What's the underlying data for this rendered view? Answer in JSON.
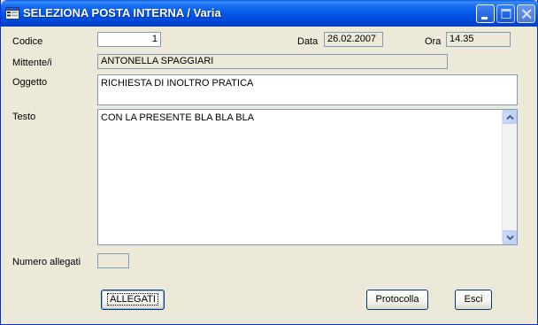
{
  "window": {
    "title": "SELEZIONA POSTA INTERNA / Varia",
    "icon": "form-icon",
    "controls": [
      "minimize-icon",
      "maximize-icon",
      "close-icon"
    ]
  },
  "form": {
    "codice": {
      "label": "Codice",
      "value": "1"
    },
    "data": {
      "label": "Data",
      "value": "26.02.2007"
    },
    "ora": {
      "label": "Ora",
      "value": "14.35"
    },
    "mittente": {
      "label": "Mittente/i",
      "value": "ANTONELLA SPAGGIARI"
    },
    "oggetto": {
      "label": "Oggetto",
      "value": "RICHIESTA DI INOLTRO PRATICA"
    },
    "testo": {
      "label": "Testo",
      "value": "CON LA PRESENTE BLA BLA BLA"
    },
    "numero_allegati": {
      "label": "Numero allegati",
      "value": ""
    }
  },
  "buttons": {
    "allegati": "ALLEGATI",
    "protocolla": "Protocolla",
    "esci": "Esci"
  }
}
